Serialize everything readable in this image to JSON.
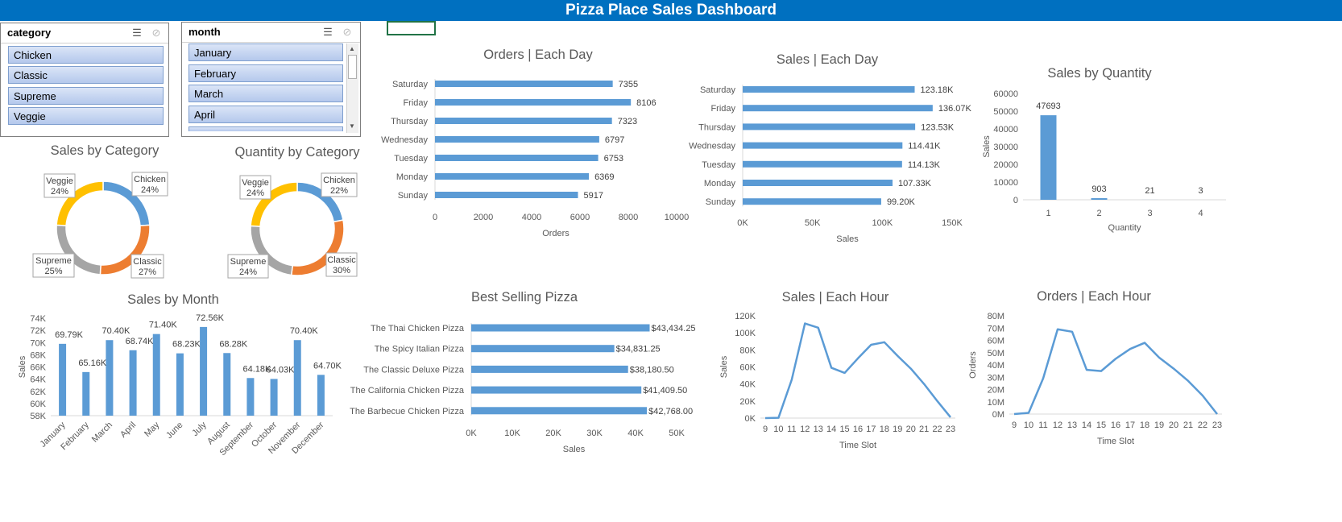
{
  "dashboard_title": "Pizza Place Sales Dashboard",
  "slicers": {
    "category": {
      "title": "category",
      "items": [
        "Chicken",
        "Classic",
        "Supreme",
        "Veggie"
      ]
    },
    "month": {
      "title": "month",
      "items": [
        "January",
        "February",
        "March",
        "April"
      ]
    }
  },
  "colors": {
    "header": "#0070c0",
    "bar": "#5b9bd5",
    "chicken": "#5b9bd5",
    "classic": "#ed7d31",
    "supreme": "#a5a5a5",
    "veggie": "#ffc000"
  },
  "chart_data": [
    {
      "id": "orders_each_day",
      "type": "bar",
      "orientation": "horizontal",
      "title": "Orders | Each Day",
      "xlabel": "Orders",
      "ylabel": "",
      "categories": [
        "Saturday",
        "Friday",
        "Thursday",
        "Wednesday",
        "Tuesday",
        "Monday",
        "Sunday"
      ],
      "values": [
        7355,
        8106,
        7323,
        6797,
        6753,
        6369,
        5917
      ],
      "data_labels": [
        "7355",
        "8106",
        "7323",
        "6797",
        "6753",
        "6369",
        "5917"
      ],
      "xlim": [
        0,
        10000
      ],
      "ticks": [
        0,
        2000,
        4000,
        6000,
        8000,
        10000
      ],
      "tick_labels": [
        "0",
        "2000",
        "4000",
        "6000",
        "8000",
        "10000"
      ]
    },
    {
      "id": "sales_each_day",
      "type": "bar",
      "orientation": "horizontal",
      "title": "Sales | Each Day",
      "xlabel": "Sales",
      "ylabel": "",
      "categories": [
        "Saturday",
        "Friday",
        "Thursday",
        "Wednesday",
        "Tuesday",
        "Monday",
        "Sunday"
      ],
      "values": [
        123180,
        136070,
        123530,
        114410,
        114130,
        107330,
        99200
      ],
      "data_labels": [
        "123.18K",
        "136.07K",
        "123.53K",
        "114.41K",
        "114.13K",
        "107.33K",
        "99.20K"
      ],
      "xlim": [
        0,
        150000
      ],
      "ticks": [
        0,
        50000,
        100000,
        150000
      ],
      "tick_labels": [
        "0K",
        "50K",
        "100K",
        "150K"
      ]
    },
    {
      "id": "sales_by_quantity",
      "type": "bar",
      "title": "Sales by Quantity",
      "xlabel": "Quantity",
      "ylabel": "Sales",
      "categories": [
        "1",
        "2",
        "3",
        "4"
      ],
      "values": [
        47693,
        903,
        21,
        3
      ],
      "data_labels": [
        "47693",
        "903",
        "21",
        "3"
      ],
      "ylim": [
        0,
        60000
      ],
      "ticks": [
        0,
        10000,
        20000,
        30000,
        40000,
        50000,
        60000
      ],
      "tick_labels": [
        "0",
        "10000",
        "20000",
        "30000",
        "40000",
        "50000",
        "60000"
      ]
    },
    {
      "id": "sales_by_category",
      "type": "pie",
      "donut": true,
      "title": "Sales by Category",
      "categories": [
        "Chicken",
        "Classic",
        "Supreme",
        "Veggie"
      ],
      "values": [
        24,
        27,
        25,
        24
      ],
      "data_labels": [
        "24%",
        "27%",
        "25%",
        "24%"
      ]
    },
    {
      "id": "quantity_by_category",
      "type": "pie",
      "donut": true,
      "title": "Quantity by Category",
      "categories": [
        "Chicken",
        "Classic",
        "Supreme",
        "Veggie"
      ],
      "values": [
        22,
        30,
        24,
        24
      ],
      "data_labels": [
        "22%",
        "30%",
        "24%",
        "24%"
      ]
    },
    {
      "id": "sales_by_month",
      "type": "bar",
      "title": "Sales by Month",
      "xlabel": "",
      "ylabel": "Sales",
      "categories": [
        "January",
        "February",
        "March",
        "April",
        "May",
        "June",
        "July",
        "August",
        "September",
        "October",
        "November",
        "December"
      ],
      "values": [
        69790,
        65160,
        70400,
        68740,
        71400,
        68230,
        72560,
        68280,
        64180,
        64030,
        70400,
        64700
      ],
      "data_labels": [
        "69.79K",
        "65.16K",
        "70.40K",
        "68.74K",
        "71.40K",
        "68.23K",
        "72.56K",
        "68.28K",
        "64.18K",
        "64.03K",
        "70.40K",
        "64.70K"
      ],
      "ylim": [
        58000,
        74000
      ],
      "ticks": [
        58000,
        60000,
        62000,
        64000,
        66000,
        68000,
        70000,
        72000,
        74000
      ],
      "tick_labels": [
        "58K",
        "60K",
        "62K",
        "64K",
        "66K",
        "68K",
        "70K",
        "72K",
        "74K"
      ]
    },
    {
      "id": "best_selling_pizza",
      "type": "bar",
      "orientation": "horizontal",
      "title": "Best Selling Pizza",
      "xlabel": "Sales",
      "ylabel": "",
      "categories": [
        "The Thai Chicken Pizza",
        "The Spicy Italian Pizza",
        "The Classic Deluxe Pizza",
        "The California Chicken Pizza",
        "The Barbecue Chicken Pizza"
      ],
      "values": [
        43434.25,
        34831.25,
        38180.5,
        41409.5,
        42768.0
      ],
      "data_labels": [
        "$43,434.25",
        "$34,831.25",
        "$38,180.50",
        "$41,409.50",
        "$42,768.00"
      ],
      "xlim": [
        0,
        50000
      ],
      "ticks": [
        0,
        10000,
        20000,
        30000,
        40000,
        50000
      ],
      "tick_labels": [
        "0K",
        "10K",
        "20K",
        "30K",
        "40K",
        "50K"
      ]
    },
    {
      "id": "sales_each_hour",
      "type": "line",
      "title": "Sales | Each Hour",
      "xlabel": "Time Slot",
      "ylabel": "Sales",
      "x": [
        "9",
        "10",
        "11",
        "12",
        "13",
        "14",
        "15",
        "16",
        "17",
        "18",
        "19",
        "20",
        "21",
        "22",
        "23"
      ],
      "values": [
        0,
        300,
        45000,
        111000,
        106000,
        59000,
        53000,
        70000,
        86000,
        89000,
        73000,
        58000,
        40000,
        20000,
        1000
      ],
      "ylim": [
        0,
        120000
      ],
      "ticks": [
        0,
        20000,
        40000,
        60000,
        80000,
        100000,
        120000
      ],
      "tick_labels": [
        "0K",
        "20K",
        "40K",
        "60K",
        "80K",
        "100K",
        "120K"
      ]
    },
    {
      "id": "orders_each_hour",
      "type": "line",
      "title": "Orders | Each Hour",
      "xlabel": "Time Slot",
      "ylabel": "Orders",
      "x": [
        "9",
        "10",
        "11",
        "12",
        "13",
        "14",
        "15",
        "16",
        "17",
        "18",
        "19",
        "20",
        "21",
        "22",
        "23"
      ],
      "values": [
        0,
        1000000,
        29000000,
        69000000,
        67000000,
        36000000,
        35000000,
        45000000,
        53000000,
        58000000,
        46000000,
        37000000,
        27000000,
        15000000,
        0
      ],
      "ylim": [
        0,
        80000000
      ],
      "ticks": [
        0,
        10000000,
        20000000,
        30000000,
        40000000,
        50000000,
        60000000,
        70000000,
        80000000
      ],
      "tick_labels": [
        "0M",
        "10M",
        "20M",
        "30M",
        "40M",
        "50M",
        "60M",
        "70M",
        "80M"
      ]
    }
  ]
}
